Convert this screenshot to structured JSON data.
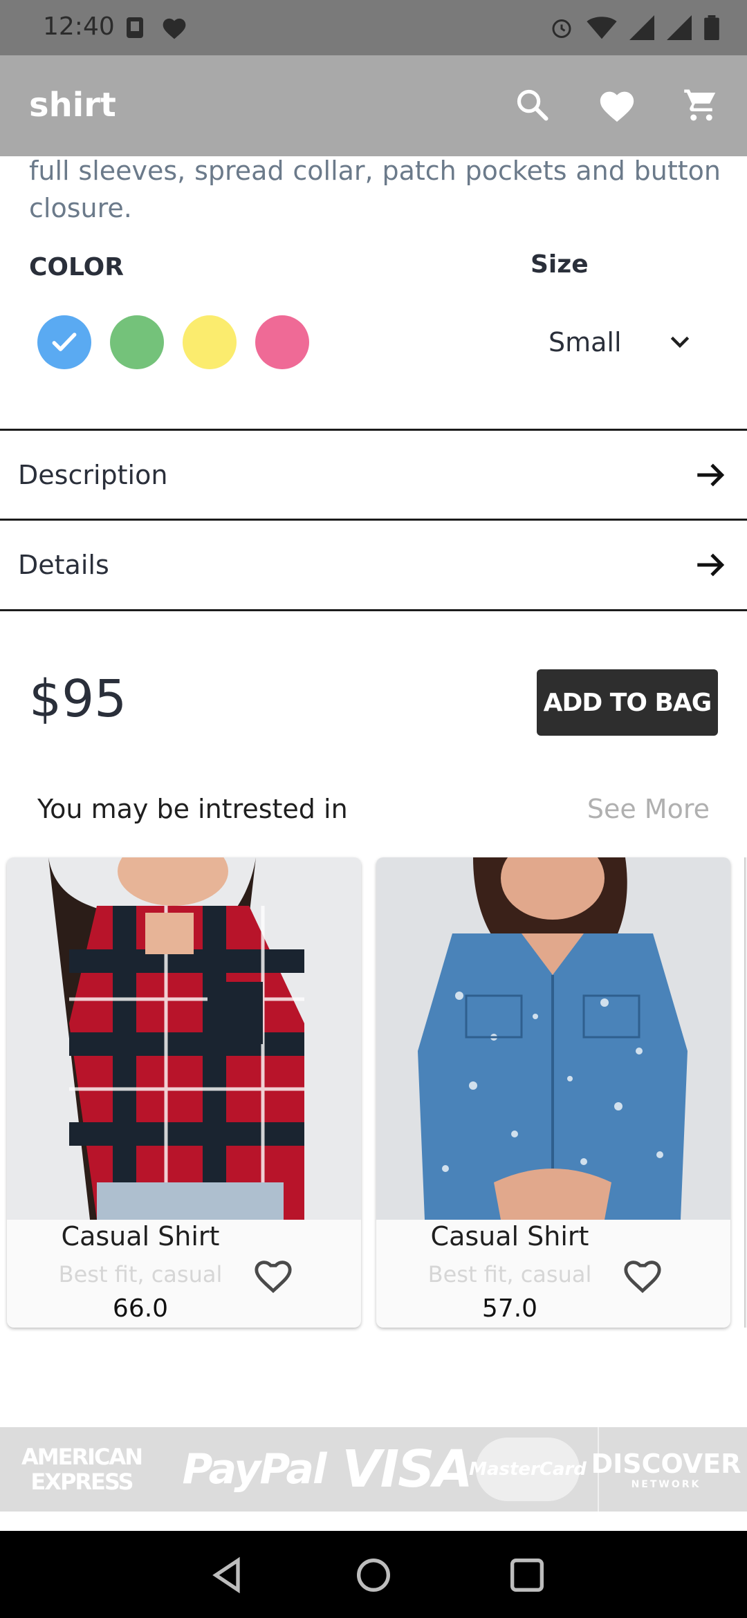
{
  "status_bar": {
    "time": "12:40",
    "icons": [
      "android-debug-icon",
      "heart-notification-icon",
      "alarm-icon",
      "wifi-icon",
      "signal-icon",
      "signal-roaming-icon",
      "battery-icon"
    ]
  },
  "app_bar": {
    "title": "shirt",
    "actions": [
      "search-icon",
      "heart-icon",
      "cart-icon"
    ],
    "background": "#a9a9a9"
  },
  "product": {
    "description_snippet": "full sleeves, spread collar, patch pockets and button closure.",
    "color_label": "COLOR",
    "size_label": "Size",
    "colors": [
      {
        "name": "blue",
        "hex": "#5aaaf2",
        "selected": true
      },
      {
        "name": "green",
        "hex": "#74c27a",
        "selected": false
      },
      {
        "name": "yellow",
        "hex": "#fbec6e",
        "selected": false
      },
      {
        "name": "pink",
        "hex": "#ef6a96",
        "selected": false
      }
    ],
    "selected_size": "Small",
    "price": "$95",
    "add_to_bag": "ADD TO BAG"
  },
  "sections": [
    {
      "label": "Description"
    },
    {
      "label": "Details"
    }
  ],
  "recommendations": {
    "title": "You may be intrested in",
    "see_more": "See More",
    "items": [
      {
        "name": "Casual Shirt",
        "subtitle": "Best fit, casual",
        "price": "66.0"
      },
      {
        "name": "Casual Shirt",
        "subtitle": "Best fit, casual",
        "price": "57.0"
      }
    ]
  },
  "payment_methods": {
    "amex_line1": "AMERICAN",
    "amex_line2": "EXPRESS",
    "paypal": "PayPal",
    "visa": "VISA",
    "mastercard": "MasterCard",
    "discover": "DISCOVER",
    "discover_sub": "NETWORK"
  },
  "nav_bar": [
    "back-icon",
    "home-icon",
    "recents-icon"
  ]
}
